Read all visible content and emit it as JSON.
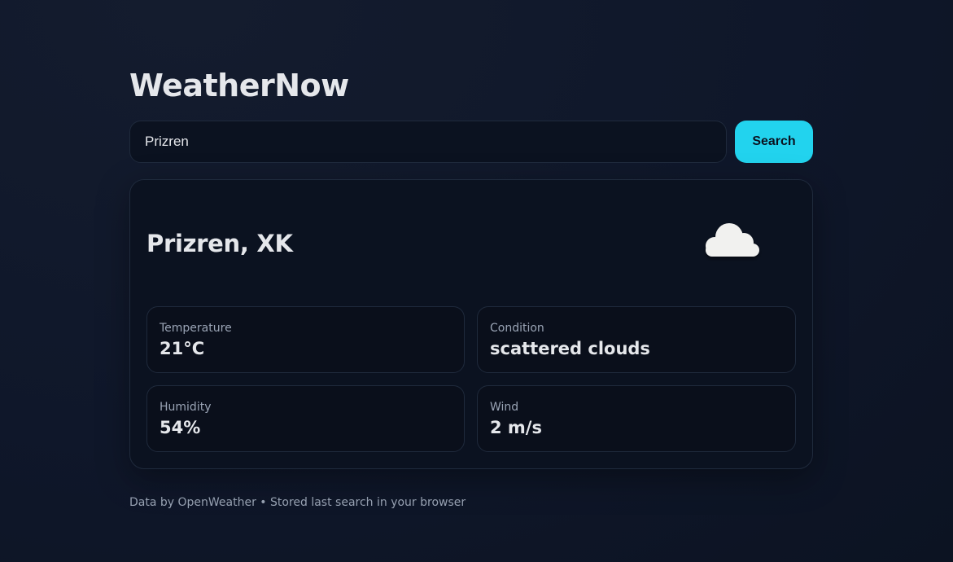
{
  "app": {
    "title": "WeatherNow"
  },
  "search": {
    "value": "Prizren",
    "button_label": "Search"
  },
  "weather": {
    "location": "Prizren, XK",
    "icon": "cloud-icon",
    "stats": [
      {
        "label": "Temperature",
        "value": "21°C"
      },
      {
        "label": "Condition",
        "value": "scattered clouds"
      },
      {
        "label": "Humidity",
        "value": "54%"
      },
      {
        "label": "Wind",
        "value": "2 m/s"
      }
    ]
  },
  "footer": {
    "text": "Data by OpenWeather • Stored last search in your browser"
  },
  "colors": {
    "accent": "#22d3ee",
    "background": "#0f172a",
    "card": "#0b1220"
  }
}
